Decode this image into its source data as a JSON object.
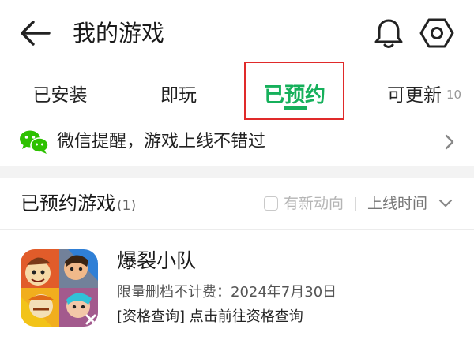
{
  "header": {
    "title": "我的游戏",
    "back_icon": "arrow-left-icon",
    "bell_icon": "bell-icon",
    "settings_icon": "gear-icon"
  },
  "tabs": [
    {
      "label": "已安装",
      "active": false
    },
    {
      "label": "即玩",
      "active": false
    },
    {
      "label": "已预约",
      "active": true
    },
    {
      "label": "可更新",
      "badge": "10",
      "active": false
    }
  ],
  "notice": {
    "text": "微信提醒，游戏上线不错过",
    "icon": "wechat-icon"
  },
  "section": {
    "title": "已预约游戏",
    "count": "(1)",
    "filter_label": "有新动向",
    "filter_checked": false,
    "sort_label": "上线时间"
  },
  "games": [
    {
      "name": "爆裂小队",
      "subtitle": "限量删档不计费：2024年7月30日",
      "link_text": "[资格查询] 点击前往资格查询"
    }
  ],
  "colors": {
    "accent": "#16b05b",
    "highlight": "#e02a2a",
    "wechat": "#2dc100"
  }
}
